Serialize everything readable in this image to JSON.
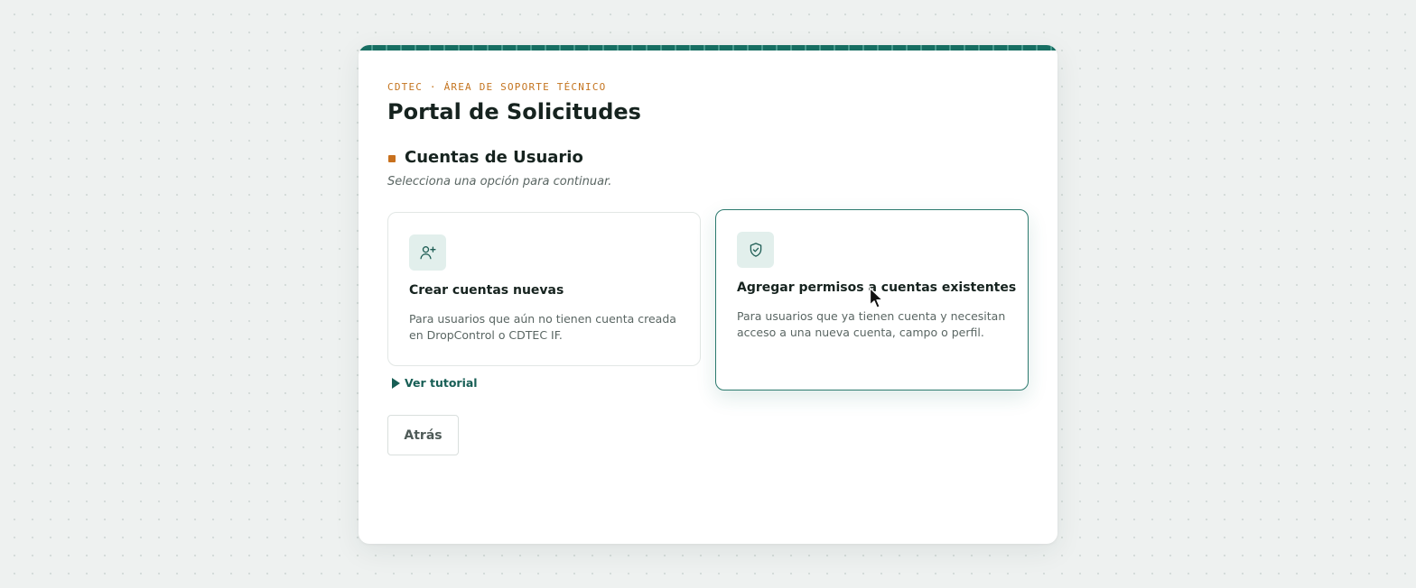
{
  "header": {
    "kicker": "CDTEC · ÁREA DE SOPORTE TÉCNICO",
    "title": "Portal de Solicitudes"
  },
  "section": {
    "title": "Cuentas de Usuario",
    "subtitle": "Selecciona una opción para continuar."
  },
  "options": [
    {
      "icon": "user-plus-icon",
      "title": "Crear cuentas nuevas",
      "description": "Para usuarios que aún no tienen cuenta creada en DropControl o CDTEC IF."
    },
    {
      "icon": "shield-check-icon",
      "title": "Agregar permisos a cuentas existentes",
      "description": "Para usuarios que ya tienen cuenta y necesitan acceso a una nueva cuenta, campo o perfil."
    }
  ],
  "tutorial_label": "Ver tutorial",
  "back_label": "Atrás",
  "colors": {
    "accent": "#176e62",
    "kicker": "#c4741f",
    "section_marker": "#c8701d",
    "icon_bg": "#e2efec"
  }
}
